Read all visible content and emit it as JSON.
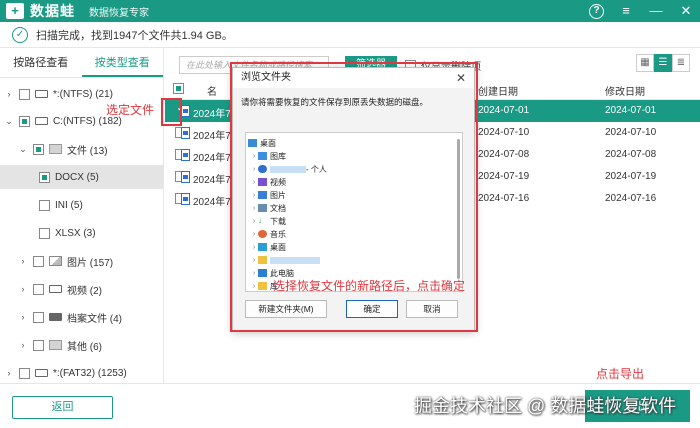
{
  "app": {
    "logo_mark": "+",
    "name": "数据蛙",
    "subtitle": "数据恢复专家"
  },
  "window_controls": {
    "help": "?",
    "menu": "≡",
    "minimize": "—",
    "close": "✕"
  },
  "status": {
    "text": "扫描完成，找到1947个文件共1.94 GB。"
  },
  "tabs": [
    "按路径查看",
    "按类型查看"
  ],
  "tree": [
    {
      "label": "*:(NTFS) (21)"
    },
    {
      "label": "C:(NTFS) (182)"
    },
    {
      "label": "文件 (13)"
    },
    {
      "label": "DOCX (5)"
    },
    {
      "label": "INI (5)"
    },
    {
      "label": "XLSX (3)"
    },
    {
      "label": "图片 (157)"
    },
    {
      "label": "视频 (2)"
    },
    {
      "label": "档案文件 (4)"
    },
    {
      "label": "其他 (6)"
    },
    {
      "label": "*:(FAT32) (1253)"
    }
  ],
  "toolbar": {
    "search_placeholder": "在此处输入文件名称或路径搜索",
    "filter": "筛选器",
    "only_deleted": "仅显示删除项"
  },
  "table": {
    "headers": {
      "name": "名",
      "created": "创建日期",
      "modified": "修改日期"
    },
    "rows": [
      {
        "name": "2024年7月",
        "created": "2024-07-01",
        "modified": "2024-07-01"
      },
      {
        "name": "2024年7月",
        "created": "2024-07-10",
        "modified": "2024-07-10"
      },
      {
        "name": "2024年7月",
        "created": "2024-07-08",
        "modified": "2024-07-08"
      },
      {
        "name": "2024年7月",
        "created": "2024-07-19",
        "modified": "2024-07-19"
      },
      {
        "name": "2024年7月",
        "created": "2024-07-16",
        "modified": "2024-07-16"
      }
    ]
  },
  "dialog": {
    "title": "浏览文件夹",
    "message": "请你将需要恢复的文件保存到原丢失数据的磁盘。",
    "items": [
      "桌面",
      "图库",
      "- 个人",
      "视频",
      "图片",
      "文档",
      "下载",
      "音乐",
      "桌面",
      "",
      "此电脑",
      "库"
    ],
    "new_folder": "新建文件夹(M)",
    "ok": "确定",
    "cancel": "取消"
  },
  "annotations": {
    "select_file": "选定文件",
    "choose_path": "选择恢复文件的新路径后，点击确定",
    "click_export": "点击导出"
  },
  "bottom": {
    "back": "返回",
    "export": "导出"
  },
  "watermark": "掘金技术社区 @ 数据蛙恢复软件",
  "colors": {
    "accent": "#1a9a85",
    "annotation": "#e0383e"
  }
}
